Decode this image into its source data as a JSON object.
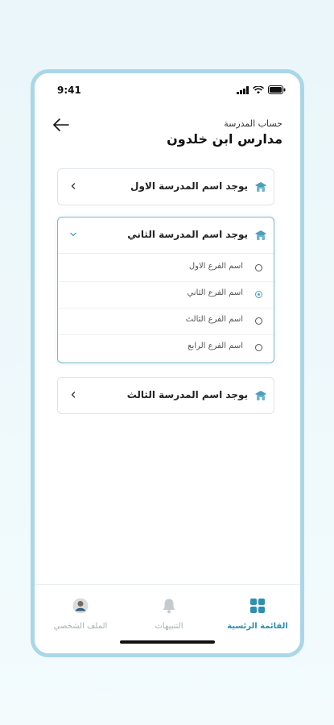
{
  "status_bar": {
    "time": "9:41"
  },
  "header": {
    "subtitle": "حساب المدرسة",
    "title": "مدارس ابن خلدون"
  },
  "schools": [
    {
      "name": "يوجد اسم المدرسة الاول",
      "expanded": false
    },
    {
      "name": "يوجد اسم المدرسة الثاني",
      "expanded": true,
      "branches": [
        {
          "label": "اسم الفرع الاول",
          "selected": false
        },
        {
          "label": "اسم الفرع الثاني",
          "selected": true
        },
        {
          "label": "اسم الفرع الثالث",
          "selected": false
        },
        {
          "label": "اسم الفرع الرابع",
          "selected": false
        }
      ]
    },
    {
      "name": "يوجد اسم المدرسة الثالث",
      "expanded": false
    }
  ],
  "tabbar": {
    "home": "القائمة الرئسية",
    "notifications": "التنبيهات",
    "profile": "الملف الشخصي"
  },
  "colors": {
    "accent": "#2f8fb0",
    "frame": "#a9d7e7",
    "inactive": "#a8b1b6"
  },
  "icons": {
    "back": "arrow-left-icon",
    "school": "school-icon",
    "home": "grid-icon",
    "notifications": "bell-icon",
    "profile": "avatar-icon"
  }
}
